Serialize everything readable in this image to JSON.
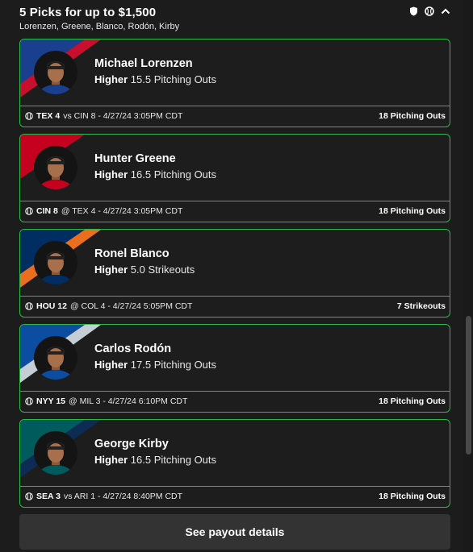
{
  "header": {
    "title": "5 Picks for up to $1,500",
    "subtitle": "Lorenzen, Greene, Blanco, Rodón, Kirby",
    "icons": [
      "shield-icon",
      "baseball-icon",
      "chevron-up-icon"
    ]
  },
  "picks": [
    {
      "name": "Michael Lorenzen",
      "direction": "Higher",
      "line": "15.5 Pitching Outs",
      "team": "TEX 4",
      "matchup": "vs CIN 8 - 4/27/24 3:05PM CDT",
      "result": "18 Pitching Outs",
      "colors": [
        "#1b3f8f",
        "#c8102e"
      ]
    },
    {
      "name": "Hunter Greene",
      "direction": "Higher",
      "line": "16.5 Pitching Outs",
      "team": "CIN 8",
      "matchup": "@ TEX 4 - 4/27/24 3:05PM CDT",
      "result": "18 Pitching Outs",
      "colors": [
        "#c6011f",
        "#1d1d1d"
      ]
    },
    {
      "name": "Ronel Blanco",
      "direction": "Higher",
      "line": "5.0 Strikeouts",
      "team": "HOU 12",
      "matchup": "@ COL 4 - 4/27/24 5:05PM CDT",
      "result": "7 Strikeouts",
      "colors": [
        "#002d62",
        "#eb6e1f"
      ]
    },
    {
      "name": "Carlos Rodón",
      "direction": "Higher",
      "line": "17.5 Pitching Outs",
      "team": "NYY 15",
      "matchup": "@ MIL 3 - 4/27/24 6:10PM CDT",
      "result": "18 Pitching Outs",
      "colors": [
        "#0c4da2",
        "#c4ced4"
      ]
    },
    {
      "name": "George Kirby",
      "direction": "Higher",
      "line": "16.5 Pitching Outs",
      "team": "SEA 3",
      "matchup": "vs ARI 1 - 4/27/24 8:40PM CDT",
      "result": "18 Pitching Outs",
      "colors": [
        "#005c5c",
        "#0c2c56"
      ]
    }
  ],
  "payout_button": "See payout details",
  "accent_color": "#2fb84c"
}
